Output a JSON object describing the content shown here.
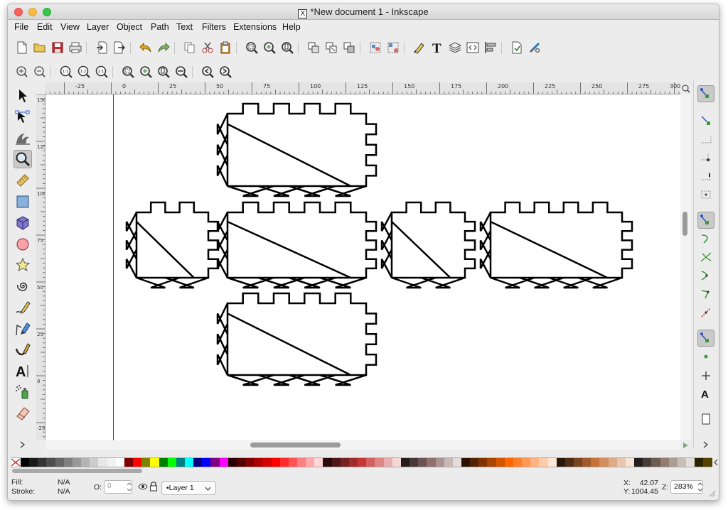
{
  "window": {
    "title": "*New document 1 - Inkscape",
    "title_icon_glyph": "X"
  },
  "menu": [
    "File",
    "Edit",
    "View",
    "Layer",
    "Object",
    "Path",
    "Text",
    "Filters",
    "Extensions",
    "Help"
  ],
  "toolbar_commands": [
    "new-document-icon",
    "open-icon",
    "save-icon",
    "print-icon",
    "import-icon",
    "export-icon",
    "undo-icon",
    "redo-icon",
    "copy-icon",
    "cut-icon",
    "paste-icon",
    "zoom-selection-icon",
    "zoom-drawing-icon",
    "zoom-page-icon",
    "duplicate-icon",
    "clone-icon",
    "unlink-clone-icon",
    "group-icon",
    "ungroup-icon",
    "fill-stroke-icon",
    "text-font-icon",
    "layers-icon",
    "xml-editor-icon",
    "align-icon",
    "document-properties-icon",
    "preferences-icon"
  ],
  "toolbar_zoom": {
    "labels": [
      "1:1",
      "1:2",
      "2:1"
    ]
  },
  "ruler": {
    "h_labels": [
      "-25",
      "0",
      "25",
      "50",
      "75",
      "100",
      "125",
      "150",
      "175",
      "200",
      "225",
      "250",
      "275",
      "300"
    ],
    "v_labels": [
      "150",
      "125",
      "100",
      "75",
      "50",
      "25",
      "0",
      "-25"
    ]
  },
  "tools": [
    "selector-arrow-icon",
    "node-edit-icon",
    "tweak-icon",
    "zoom-tool-icon",
    "measure-icon",
    "rectangle-icon",
    "box-3d-icon",
    "ellipse-icon",
    "star-icon",
    "spiral-icon",
    "pencil-icon",
    "pen-icon",
    "calligraphy-icon",
    "text-tool-icon",
    "spray-icon",
    "eraser-icon"
  ],
  "snap_tools": [
    "snap-enable-icon",
    "snap-bbox-icon",
    "snap-bbox-edge-icon",
    "snap-bbox-corner-icon",
    "snap-bbox-midpoint-icon",
    "snap-bbox-center-icon",
    "snap-nodes-icon",
    "snap-path-icon",
    "snap-intersection-icon",
    "snap-cusp-icon",
    "snap-smooth-icon",
    "snap-midpoint-icon",
    "snap-others-icon",
    "snap-center-icon",
    "snap-rotation-center-icon",
    "snap-text-baseline-icon",
    "snap-page-border-icon"
  ],
  "palette": [
    "#000000",
    "#1a1a1a",
    "#333333",
    "#4d4d4d",
    "#666666",
    "#808080",
    "#999999",
    "#b3b3b3",
    "#cccccc",
    "#e6e6e6",
    "#f2f2f2",
    "#ffffff",
    "#800000",
    "#ff0000",
    "#808000",
    "#ffff00",
    "#008000",
    "#00ff00",
    "#008080",
    "#00ffff",
    "#000080",
    "#0000ff",
    "#800080",
    "#ff00ff",
    "#2b0000",
    "#550000",
    "#800000",
    "#aa0000",
    "#d40000",
    "#ff0000",
    "#ff2a2a",
    "#ff5555",
    "#ff8080",
    "#ffaaaa",
    "#ffd5d5",
    "#280b0b",
    "#501616",
    "#782121",
    "#a02c2c",
    "#c83737",
    "#d35f5f",
    "#de8787",
    "#e9afaf",
    "#f4d7d7",
    "#241c1c",
    "#483737",
    "#6c5353",
    "#916f6f",
    "#ac9393",
    "#c8b7b7",
    "#e3dbdb",
    "#2b1100",
    "#552200",
    "#803300",
    "#aa4400",
    "#d45500",
    "#ff6600",
    "#ff7f2a",
    "#ff9955",
    "#ffb380",
    "#ffccaa",
    "#ffe6d5",
    "#28170b",
    "#502d16",
    "#784421",
    "#a05a2c",
    "#c87137",
    "#d38d5f",
    "#deaa87",
    "#e9c6af",
    "#f4e3d7",
    "#241f1c",
    "#483e37",
    "#6c5d53",
    "#917c6f",
    "#ac9d93",
    "#c8beb7",
    "#e3dedb",
    "#2b2200",
    "#554400"
  ],
  "status": {
    "fill_label": "Fill:",
    "fill_value": "N/A",
    "stroke_label": "Stroke:",
    "stroke_value": "N/A",
    "opacity_label": "O:",
    "opacity_value": "0",
    "layer": "•Layer 1",
    "x_label": "X:",
    "x_value": "42.07",
    "y_label": "Y:",
    "y_value": "1004.45",
    "zoom_label": "Z:",
    "zoom_value": "283%"
  }
}
